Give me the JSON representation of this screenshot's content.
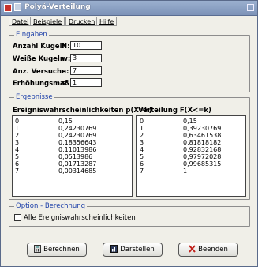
{
  "window": {
    "title": "Polyá-Verteilung"
  },
  "menu": [
    "Datei",
    "Beispiele",
    "Drucken",
    "Hilfe"
  ],
  "eingaben": {
    "legend": "Eingaben",
    "fields": [
      {
        "label": "Anzahl Kugeln",
        "symbol": "N:",
        "value": "10"
      },
      {
        "label": "Weiße Kugeln",
        "symbol": "w:",
        "value": "3"
      },
      {
        "label": "Anz. Versuche",
        "symbol": "n:",
        "value": "7"
      },
      {
        "label": "Erhöhungsmaß",
        "symbol": "s:",
        "value": "1"
      }
    ]
  },
  "ergebnisse": {
    "legend": "Ergebnisse",
    "left_header": "Ereigniswahrscheinlichkeiten p(X=k)",
    "right_header": "Verteilung F(X<=k)",
    "left_rows": [
      [
        "0",
        "0,15"
      ],
      [
        "1",
        "0,24230769"
      ],
      [
        "2",
        "0,24230769"
      ],
      [
        "3",
        "0,18356643"
      ],
      [
        "4",
        "0,11013986"
      ],
      [
        "5",
        "0,0513986"
      ],
      [
        "6",
        "0,01713287"
      ],
      [
        "7",
        "0,00314685"
      ]
    ],
    "right_rows": [
      [
        "0",
        "0,15"
      ],
      [
        "1",
        "0,39230769"
      ],
      [
        "2",
        "0,63461538"
      ],
      [
        "3",
        "0,81818182"
      ],
      [
        "4",
        "0,92832168"
      ],
      [
        "5",
        "0,97972028"
      ],
      [
        "6",
        "0,99685315"
      ],
      [
        "7",
        "1"
      ]
    ]
  },
  "option": {
    "legend": "Option - Berechnung",
    "checkbox_label": "Alle Ereigniswahrscheinlichkeiten",
    "checked": false
  },
  "buttons": {
    "berechnen": "Berechnen",
    "darstellen": "Darstellen",
    "beenden": "Beenden"
  }
}
